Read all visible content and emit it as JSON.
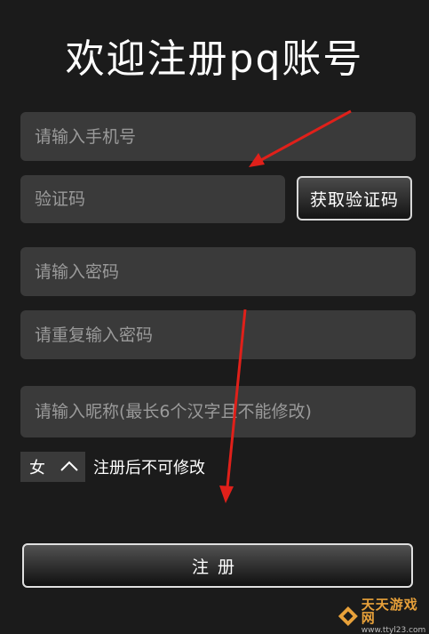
{
  "header": {
    "title": "欢迎注册pq账号"
  },
  "form": {
    "phone_placeholder": "请输入手机号",
    "code_placeholder": "验证码",
    "get_code_label": "获取验证码",
    "password_placeholder": "请输入密码",
    "repeat_password_placeholder": "请重复输入密码",
    "nickname_placeholder": "请输入昵称(最长6个汉字且不能修改)",
    "gender": {
      "selected": "女",
      "icon": "chevron-up-icon"
    },
    "gender_note": "注册后不可修改",
    "register_label": "注册"
  },
  "annotations": {
    "arrow_color": "#e0201a",
    "arrow_count": 2
  },
  "watermark": {
    "name": "天天游戏网",
    "url": "www.ttyl23.com"
  },
  "colors": {
    "background": "#1b1b1b",
    "field": "#3a3a3a",
    "text": "#ffffff",
    "placeholder": "#9a9a9a"
  }
}
